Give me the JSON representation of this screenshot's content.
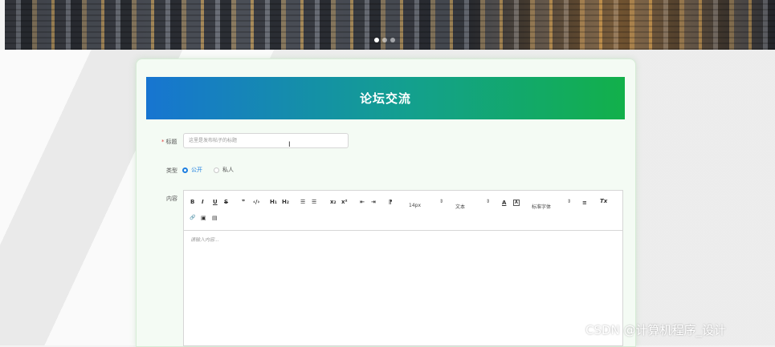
{
  "title": "论坛交流",
  "form": {
    "title_label": "标题",
    "required_mark": "*",
    "title_placeholder": "这里是发布帖子的标题",
    "type_label": "类型",
    "type_options": [
      "公开",
      "私人"
    ],
    "content_label": "内容",
    "content_placeholder": "请输入内容..."
  },
  "toolbar": {
    "bold": "B",
    "italic": "I",
    "underline": "U",
    "strike": "S",
    "quote": "❞",
    "code": "‹/›",
    "h1": "H₁",
    "h2": "H₂",
    "ol": "☰",
    "ul": "☰",
    "sub": "x₂",
    "sup": "x²",
    "indent_left": "⇤",
    "indent_right": "⇥",
    "direction": "⁋",
    "size_value": "14px",
    "size_arrow": "⇕",
    "style_value": "文本",
    "style_arrow": "⇕",
    "font_color": "A",
    "bg_color": "A",
    "font_value": "标准字体",
    "font_arrow": "⇕",
    "align": "≡",
    "clear": "Tx",
    "link": "🔗",
    "image": "▣",
    "video": "▤"
  },
  "watermark": "CSDN @计算机程序_设计"
}
